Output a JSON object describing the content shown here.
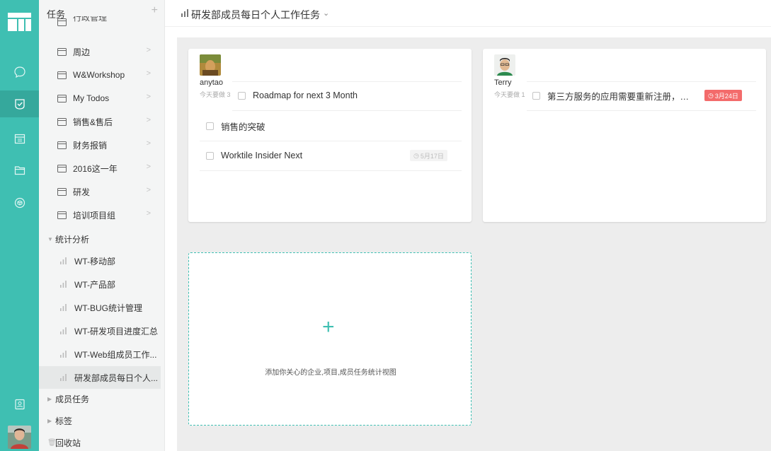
{
  "app": {
    "accent": "#3fbfb2",
    "rail_items": [
      {
        "name": "message-icon",
        "active": false
      },
      {
        "name": "task-check-icon",
        "active": true
      },
      {
        "name": "calendar-icon",
        "active": false
      },
      {
        "name": "folder-icon",
        "active": false
      },
      {
        "name": "cube-icon",
        "active": false
      },
      {
        "name": "contacts-icon",
        "active": false
      }
    ]
  },
  "nav": {
    "title": "任务",
    "add_label": "+",
    "clipped_item": "行政管理",
    "projects": [
      "周边",
      "W&Workshop",
      "My Todos",
      "销售&售后",
      "财务报销",
      "2016这一年",
      "研发",
      "培训项目组"
    ],
    "stats_group": "统计分析",
    "stats": [
      "WT-移动部",
      "WT-产品部",
      "WT-BUG统计管理",
      "WT-研发项目进度汇总",
      "WT-Web组成员工作...",
      "研发部成员每日个人..."
    ],
    "selected_stat_index": 5,
    "member_group": "成员任务",
    "tags_group": "标签",
    "trash": "回收站"
  },
  "header": {
    "title": "研发部成员每日个人工作任务",
    "caret": "⌄"
  },
  "cards": [
    {
      "user": "anytao",
      "today_label": "今天要做 3",
      "tasks": [
        {
          "title": "Roadmap for next 3 Month",
          "due": ""
        },
        {
          "title": "销售的突破",
          "due": ""
        },
        {
          "title": "Worktile Insider Next",
          "due": "5月17日",
          "due_style": "grey"
        }
      ]
    },
    {
      "user": "Terry",
      "today_label": "今天要做 1",
      "tasks": [
        {
          "title": "第三方服务的应用需要重新注册，应...",
          "due": "3月24日",
          "due_style": "red"
        }
      ]
    }
  ],
  "add_card": {
    "plus": "+",
    "text": "添加你关心的企业,项目,成员任务统计视图"
  }
}
